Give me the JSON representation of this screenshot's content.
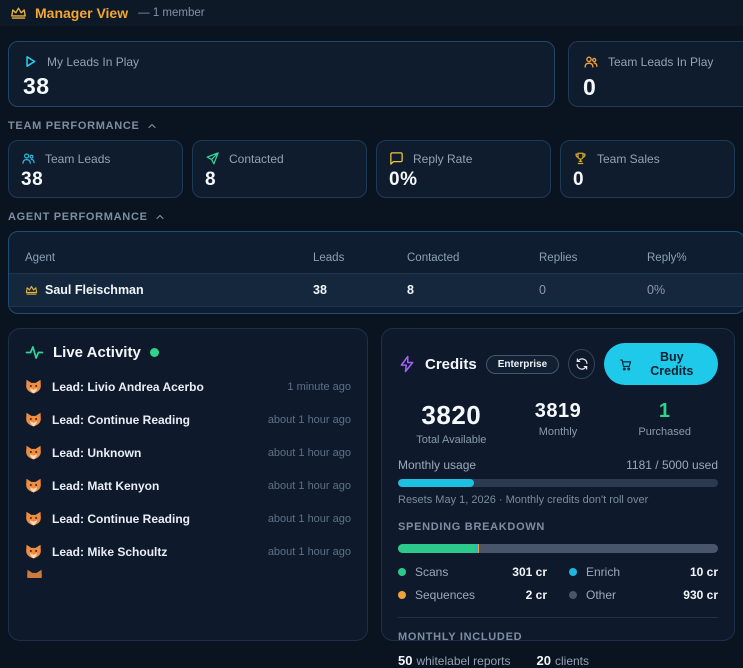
{
  "header": {
    "title": "Manager View",
    "member_note": "— 1 member"
  },
  "top_stats": {
    "my_leads": {
      "label": "My Leads In Play",
      "value": "38"
    },
    "team_leads": {
      "label": "Team Leads In Play",
      "value": "0"
    }
  },
  "team_performance": {
    "section_title": "TEAM PERFORMANCE",
    "cards": [
      {
        "label": "Team Leads",
        "value": "38",
        "icon": "people-icon"
      },
      {
        "label": "Contacted",
        "value": "8",
        "icon": "send-icon"
      },
      {
        "label": "Reply Rate",
        "value": "0%",
        "icon": "chat-icon"
      },
      {
        "label": "Team Sales",
        "value": "0",
        "icon": "trophy-icon"
      }
    ]
  },
  "agent_performance": {
    "section_title": "AGENT PERFORMANCE",
    "columns": [
      "Agent",
      "Leads",
      "Contacted",
      "Replies",
      "Reply%"
    ],
    "rows": [
      {
        "agent": "Saul Fleischman",
        "leads": "38",
        "contacted": "8",
        "replies": "0",
        "reply_pct": "0%"
      }
    ]
  },
  "live_activity": {
    "title": "Live Activity",
    "items": [
      {
        "label": "Lead: Livio Andrea Acerbo",
        "time": "1 minute ago"
      },
      {
        "label": "Lead: Continue Reading",
        "time": "about 1 hour ago"
      },
      {
        "label": "Lead: Unknown",
        "time": "about 1 hour ago"
      },
      {
        "label": "Lead: Matt Kenyon",
        "time": "about 1 hour ago"
      },
      {
        "label": "Lead: Continue Reading",
        "time": "about 1 hour ago"
      },
      {
        "label": "Lead: Mike Schoultz",
        "time": "about 1 hour ago"
      }
    ]
  },
  "credits": {
    "title": "Credits",
    "plan_badge": "Enterprise",
    "buy_button_label": "Buy Credits",
    "stats": [
      {
        "value": "3820",
        "label": "Total Available"
      },
      {
        "value": "3819",
        "label": "Monthly"
      },
      {
        "value": "1",
        "label": "Purchased"
      }
    ],
    "monthly_usage": {
      "label": "Monthly usage",
      "used_text": "1181 / 5000 used",
      "used": 1181,
      "total": 5000,
      "percent": 23.6,
      "reset_note": "Resets May 1, 2026 · Monthly credits don't roll over"
    },
    "spending_breakdown": {
      "section_title": "SPENDING BREAKDOWN",
      "segments_percent": {
        "scans": 24.2,
        "enrich": 0.8,
        "sequences": 0.2
      },
      "legend": [
        {
          "name": "Scans",
          "amount": "301 cr",
          "color": "#2bc98c"
        },
        {
          "name": "Enrich",
          "amount": "10 cr",
          "color": "#1fb6e0"
        },
        {
          "name": "Sequences",
          "amount": "2 cr",
          "color": "#f0a13a"
        },
        {
          "name": "Other",
          "amount": "930 cr",
          "color": "#48556a"
        }
      ]
    },
    "monthly_included": {
      "section_title": "MONTHLY INCLUDED",
      "items": [
        {
          "value": "50",
          "label": "whitelabel reports"
        },
        {
          "value": "20",
          "label": "clients"
        }
      ]
    }
  },
  "colors": {
    "accent_gold": "#f2a732",
    "accent_cyan": "#1fc9ea",
    "accent_green": "#2fd48b",
    "accent_purple": "#a462f5",
    "usage_fill": "#1cc0e0",
    "card_border": "#26456a",
    "table_border": "#1d4d74",
    "page_bg": "#0a1420"
  }
}
